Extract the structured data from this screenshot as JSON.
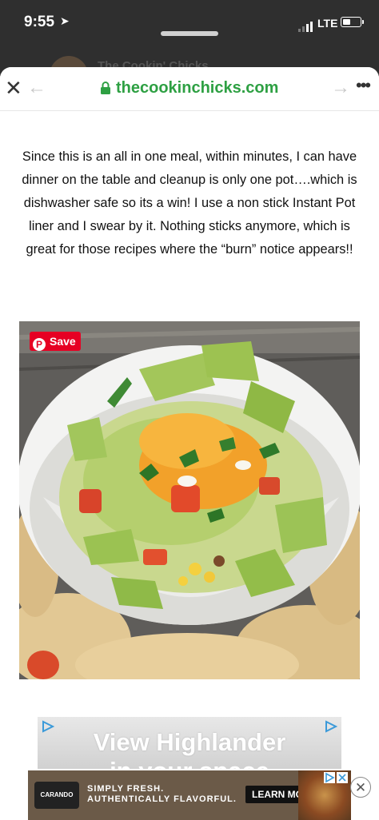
{
  "status_bar": {
    "time": "9:55",
    "network": "LTE"
  },
  "background_page": {
    "title": "The Cookin' Chicks"
  },
  "browser": {
    "url": "thecookinchicks.com"
  },
  "article": {
    "paragraph": "Since this is an all in one meal, within minutes, I can have dinner on the table and cleanup is only one pot….which is dishwasher safe so its a win! I use a non stick Instant Pot liner and I swear by it. Nothing sticks anymore, which is great for those recipes where the “burn” notice appears!!"
  },
  "image": {
    "save_label": "Save"
  },
  "ad_top": {
    "line1": "View Highlander",
    "line2": "in your space"
  },
  "ad_bottom": {
    "brand": "CARANDO",
    "slogan_line1": "SIMPLY FRESH.",
    "slogan_line2": "AUTHENTICALLY FLAVORFUL.",
    "cta": "LEARN MORE"
  },
  "colors": {
    "url_green": "#2ea043",
    "pinterest_red": "#e60023"
  }
}
